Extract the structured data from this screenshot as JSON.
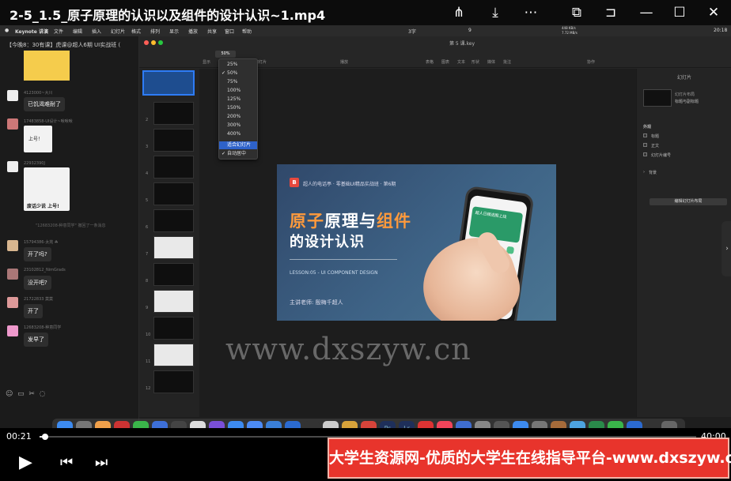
{
  "player": {
    "title": "2-5_1.5_原子原理的认识以及组件的设计认识~1.mp4",
    "current_time": "00:21",
    "end_time": "40:00",
    "progress": 0.009,
    "icons": [
      "share-icon",
      "download-icon",
      "more-icon",
      "pip-icon",
      "pin-icon",
      "minimize-icon",
      "maximize-icon",
      "close-icon"
    ],
    "banner": "大学生资源网-优质的大学生在线指导平台-www.dxszyw.cn",
    "watermark": "www.dxszyw.cn"
  },
  "mac_menubar": {
    "app": "Keynote 讲演",
    "items": [
      "文件",
      "编辑",
      "插入",
      "幻灯片",
      "格式",
      "排列",
      "显示",
      "播放",
      "共享",
      "窗口",
      "帮助"
    ],
    "right": [
      "3字",
      "9",
      "448 KB/s",
      "7.72 MB/s",
      "20:18"
    ]
  },
  "chat": {
    "header": "【今晚8：30有课】虎课@超人6期 UI实战班 (",
    "messages": [
      {
        "user": "4123000~大川",
        "text": "已饥渴难耐了"
      },
      {
        "user": "17483858-UI设计~啾啾啾",
        "text": "上号！"
      },
      {
        "user": "22932390J",
        "sticker": "废话少说 上号!"
      },
      {
        "user": "15794386-太芫 ☘",
        "text": "开了吗?"
      },
      {
        "user": "23102812_NimGrads",
        "text": "没开吧?"
      },
      {
        "user": "21722833 莫莫",
        "text": "开了"
      },
      {
        "user": "12683208-种意同学",
        "text": "发早了"
      }
    ],
    "system": "\"12683208-种意同学\" 撤回了一条消息"
  },
  "keynote": {
    "doc_title": "第 5 课.key",
    "toolbar": {
      "zoom": "50%",
      "items": [
        "显示",
        "缩放",
        "添加幻灯片",
        "播放",
        "表格",
        "图表",
        "文本",
        "形状",
        "媒体",
        "批注",
        "协作"
      ]
    },
    "zoom_menu": {
      "options": [
        "25%",
        "50%",
        "75%",
        "100%",
        "125%",
        "150%",
        "200%",
        "300%",
        "400%"
      ],
      "checked": "50%",
      "fit": "适合幻灯片",
      "auto_center": "自动居中"
    },
    "slide_numbers": [
      "1",
      "2",
      "3",
      "4",
      "5",
      "6",
      "7",
      "8",
      "9",
      "10",
      "11",
      "12"
    ],
    "slide": {
      "series": "超人的电话亭 · 零基础UI精品实战班 · 第6期",
      "title_a": "原子",
      "title_b": "原理与",
      "title_c": "组件",
      "subtitle": "的设计认识",
      "lesson": "LESSON:05 - UI COMPONENT DESIGN",
      "teacher": "主讲老师: 殷梅千超人",
      "phone_banner": "超人日精选图上线"
    },
    "inspector": {
      "title": "幻灯片",
      "layout_label": "幻灯片布局",
      "layout_value": "标题与副标题",
      "appearance": "外观",
      "options": [
        "标题",
        "正文",
        "幻灯片编号"
      ],
      "background": "背景",
      "edit_button": "编辑幻灯片布局"
    }
  },
  "colors": {
    "accent": "#2e7cf6",
    "slide_accent": "#ff9a3c",
    "banner": "#e8342c"
  }
}
